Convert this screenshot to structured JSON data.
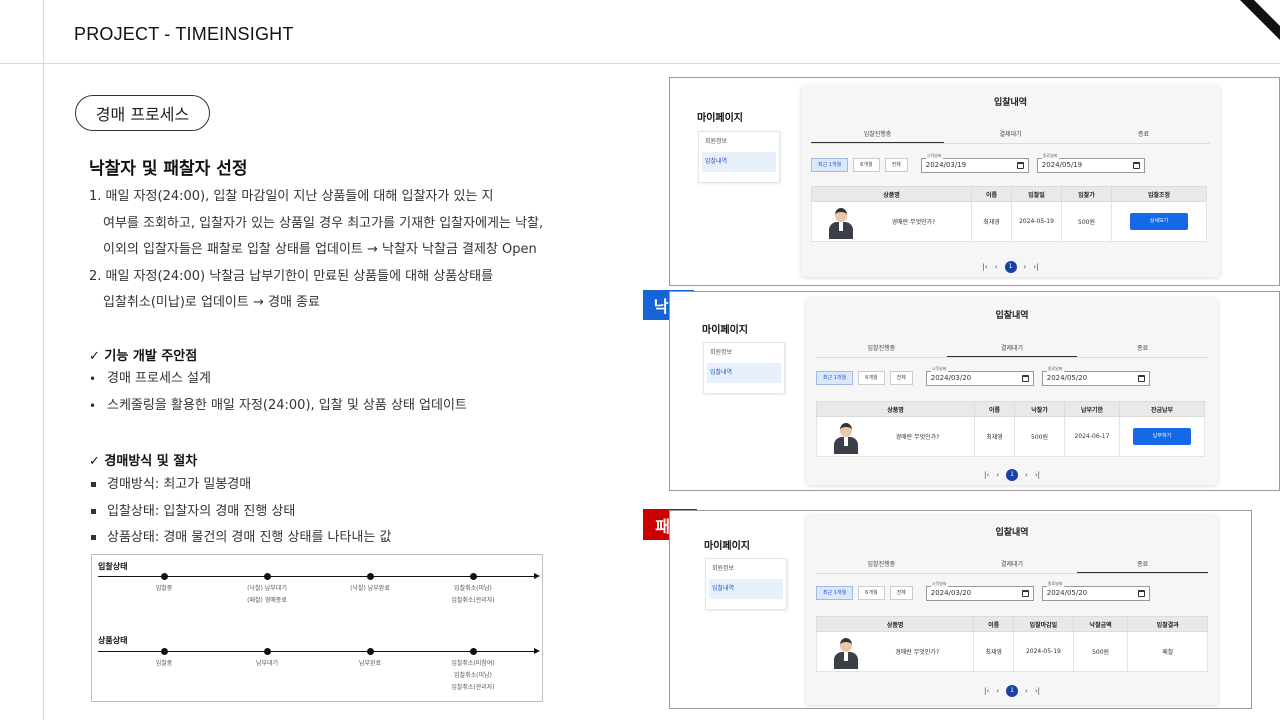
{
  "header": {
    "title": "PROJECT - TIMEINSIGHT"
  },
  "pill": {
    "label": "경매 프로세스"
  },
  "section": {
    "title": "낙찰자 및 패찰자 선정",
    "lines": [
      "1. 매일 자정(24:00), 입찰 마감일이 지난 상품들에 대해 입찰자가 있는 지",
      "여부를 조회하고, 입찰자가 있는 상품일 경우 최고가를 기재한 입찰자에게는 낙찰,",
      "이외의 입찰자들은 패찰로 입찰 상태를 업데이트 → 낙찰자 낙찰금 결제창 Open",
      "2. 매일 자정(24:00) 낙찰금 납부기한이 만료된 상품들에 대해 상품상태를",
      "입찰취소(미납)로 업데이트 → 경매 종료"
    ]
  },
  "caution": {
    "title": "✓ 기능 개발 주안점",
    "items": [
      "경매 프로세스 설계",
      "스케줄링을 활용한 매일 자정(24:00), 입찰  및 상품 상태 업데이트"
    ]
  },
  "method": {
    "title": "✓ 경매방식 및 절차",
    "items": [
      "경매방식: 최고가 밀봉경매",
      "입찰상태: 입찰자의 경매 진행 상태",
      "상품상태: 경매 물건의 경매 진행 상태를 나타내는 값"
    ]
  },
  "diagram": {
    "bid_label": "입찰상태",
    "bid_nodes": [
      [
        "입찰중"
      ],
      [
        "(낙찰) 납부대기",
        "(패찰) 경매종료"
      ],
      [
        "(낙찰) 납부완료"
      ],
      [
        "입찰취소(미납)",
        "입찰취소(관리자)"
      ]
    ],
    "product_label": "상품상태",
    "product_nodes": [
      [
        "입찰중"
      ],
      [
        "납부대기"
      ],
      [
        "납부완료"
      ],
      [
        "입찰취소(미참여)",
        "입찰취소(미납)",
        "입찰취소(관리자)"
      ]
    ]
  },
  "panels": {
    "mypage": "마이페이지",
    "sidebar": [
      "회원정보",
      "입찰내역"
    ],
    "card_title": "입찰내역",
    "tabs": [
      "입찰진행중",
      "결제대기",
      "종료"
    ],
    "filter_buttons": [
      "최근 1개월",
      "6개월",
      "전체"
    ],
    "start_label": "시작날짜",
    "end_label": "종료날짜",
    "product_name": "경매란 무엇인가?",
    "bidder": "최재영",
    "price": "500원",
    "pager": [
      "|‹",
      "‹",
      "1",
      "›",
      "›|"
    ],
    "p1": {
      "start": "2024/03/19",
      "end": "2024/05/19",
      "headers": [
        "상품명",
        "이름",
        "입찰일",
        "입찰가",
        "입찰조정"
      ],
      "date": "2024-05-19",
      "button": "상세보기"
    },
    "p2": {
      "tag": "낙찰",
      "start": "2024/03/20",
      "end": "2024/05/20",
      "headers": [
        "상품명",
        "이름",
        "낙찰가",
        "납부기한",
        "잔금납부"
      ],
      "date": "2024-06-17",
      "button": "납부하기"
    },
    "p3": {
      "tag": "패찰",
      "start": "2024/03/20",
      "end": "2024/05/20",
      "headers": [
        "상품명",
        "이름",
        "입찰마감일",
        "낙찰금액",
        "입찰결과"
      ],
      "date": "2024-05-19",
      "result": "패찰"
    }
  },
  "colors": {
    "win_tag": "#1565d8",
    "lose_tag": "#cc0000",
    "primary_button": "#1669e6"
  }
}
